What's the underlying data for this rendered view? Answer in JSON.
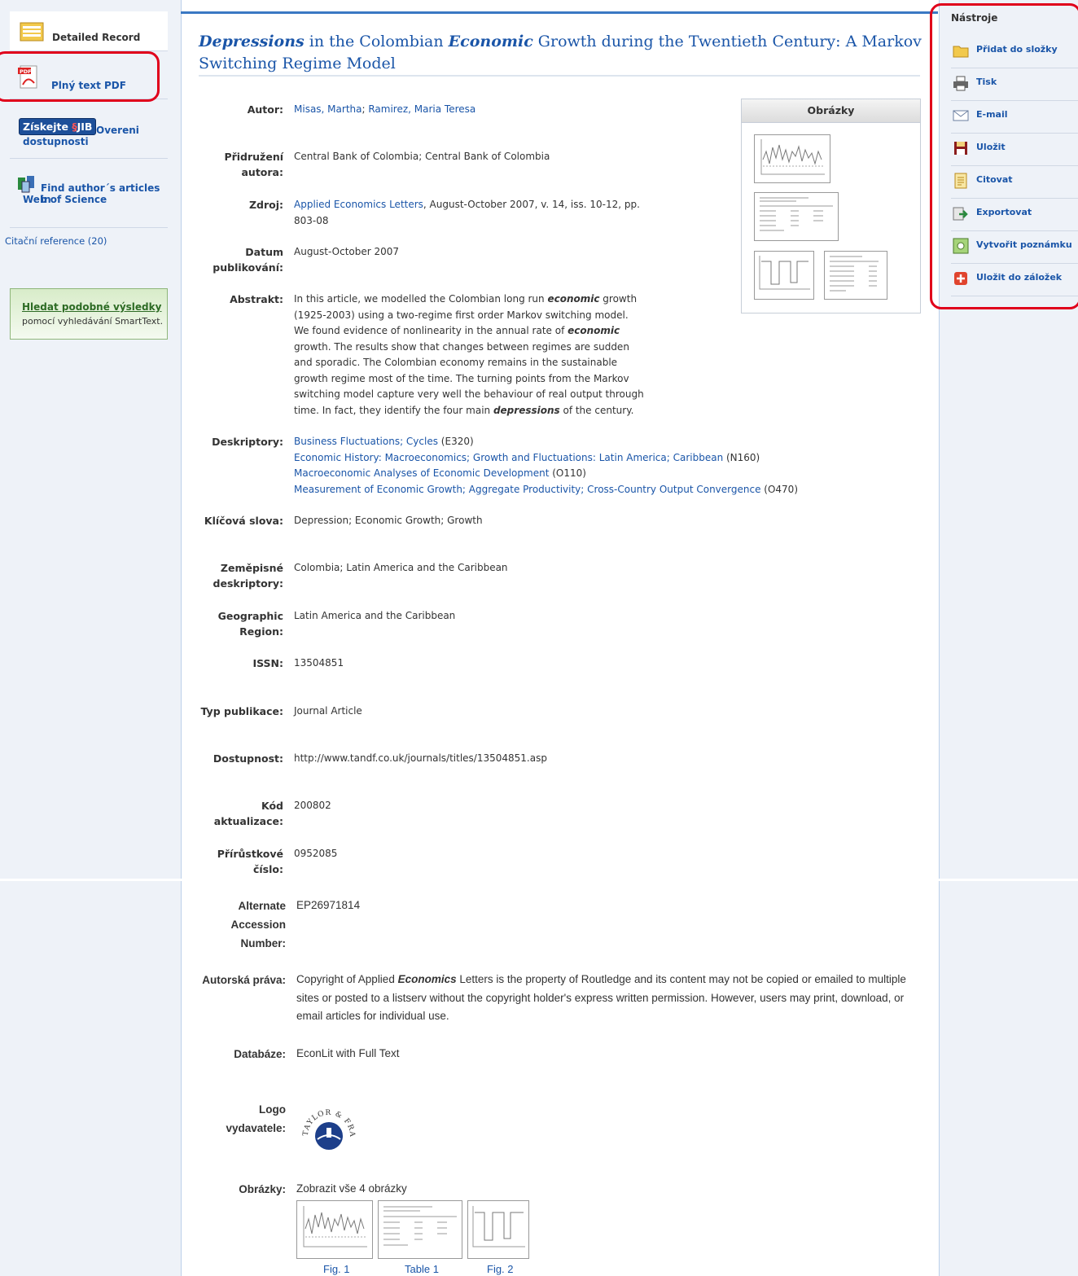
{
  "left": {
    "detailed_record": "Detailed Record",
    "pdf": "Plný text PDF",
    "jib_badge": "Získejte",
    "jib_badge2": "JIB",
    "jib_label1": "Overeni",
    "jib_label2": "dostupnosti",
    "wos_label1": "Find author´s articles in",
    "wos_label2": "Web of Science",
    "citations": "Citační reference (20)",
    "smart_title": "Hledat podobné výsledky",
    "smart_sub": "pomocí vyhledávání SmartText."
  },
  "tools": {
    "title": "Nástroje",
    "items": [
      {
        "label": "Přidat do složky",
        "icon": "folder-icon"
      },
      {
        "label": "Tisk",
        "icon": "printer-icon"
      },
      {
        "label": "E-mail",
        "icon": "email-icon"
      },
      {
        "label": "Uložit",
        "icon": "save-icon"
      },
      {
        "label": "Citovat",
        "icon": "cite-icon"
      },
      {
        "label": "Exportovat",
        "icon": "export-icon"
      },
      {
        "label": "Vytvořit poznámku",
        "icon": "note-icon"
      },
      {
        "label": "Uložit do záložek",
        "icon": "bookmark-icon"
      }
    ]
  },
  "title": {
    "w1": "Depressions",
    "t1": " in the Colombian ",
    "w2": "Economic",
    "t2": " Growth during the Twentieth Century: A Markov Switching Regime Model"
  },
  "images_box": {
    "title": "Obrázky"
  },
  "fields": {
    "autor_k": "Autor:",
    "autor_v1": "Misas, Martha",
    "autor_v2": "Ramirez, Maria Teresa",
    "prid_k": "Přidružení autora:",
    "prid_v": "Central Bank of Colombia; Central Bank of Colombia",
    "zdroj_k": "Zdroj:",
    "zdroj_link": "Applied Economics Letters",
    "zdroj_v": ", August-October 2007, v. 14, iss. 10-12, pp. 803-08",
    "datum_k": "Datum publikování:",
    "datum_v": "August-October 2007",
    "abs_k": "Abstrakt:",
    "abs_1": "In this article, we modelled the Colombian long run ",
    "abs_em1": "economic",
    "abs_2": " growth (1925-2003) using a two-regime first order Markov switching model. We found evidence of nonlinearity in the annual rate of ",
    "abs_em2": "economic",
    "abs_3": " growth. The results show that changes between regimes are sudden and sporadic. The Colombian economy remains in the sustainable growth regime most of the time. The turning points from the Markov switching model capture very well the behaviour of real output through time. In fact, they identify the four main ",
    "abs_em3": "depressions",
    "abs_4": " of the century.",
    "desk_k": "Deskriptory:",
    "desk": [
      {
        "link": "Business Fluctuations; Cycles",
        "code": " (E320)"
      },
      {
        "link": "Economic History: Macroeconomics; Growth and Fluctuations: Latin America; Caribbean",
        "code": " (N160)"
      },
      {
        "link": "Macroeconomic Analyses of Economic Development",
        "code": " (O110)"
      },
      {
        "link": "Measurement of Economic Growth; Aggregate Productivity; Cross-Country Output Convergence",
        "code": " (O470)"
      }
    ],
    "klic_k": "Klíčová slova:",
    "klic_v": "Depression; Economic Growth; Growth",
    "zem_k": "Zeměpisné deskriptory:",
    "zem_v": "Colombia; Latin America and the Caribbean",
    "geo_k": "Geographic Region:",
    "geo_v": "Latin America and the Caribbean",
    "issn_k": "ISSN:",
    "issn_v": "13504851",
    "typ_k": "Typ publikace:",
    "typ_v": "Journal Article",
    "dost_k": "Dostupnost:",
    "dost_v": "http://www.tandf.co.uk/journals/titles/13504851.asp",
    "kod_k": "Kód aktualizace:",
    "kod_v": "200802",
    "prir_k": "Přírůstkové číslo:",
    "prir_v": "0952085",
    "alt_k": "Alternate Accession Number:",
    "alt_v": "EP26971814",
    "aut_k": "Autorská práva:",
    "aut_1": "Copyright of Applied ",
    "aut_em": "Economics",
    "aut_2": " Letters is the property of Routledge and its content may not be copied or emailed to multiple sites or posted to a listserv without the copyright holder's express written permission. However, users may print, download, or email articles for individual use.",
    "db_k": "Databáze:",
    "db_v": "EconLit with Full Text",
    "logo_k": "Logo vydavatele:",
    "logo_text": "TAYLOR & FRANCIS",
    "obr_k": "Obrázky:",
    "obr_link": "Zobrazit vše 4 obrázky",
    "figs": [
      "Fig. 1",
      "Table 1",
      "Fig. 2"
    ]
  }
}
